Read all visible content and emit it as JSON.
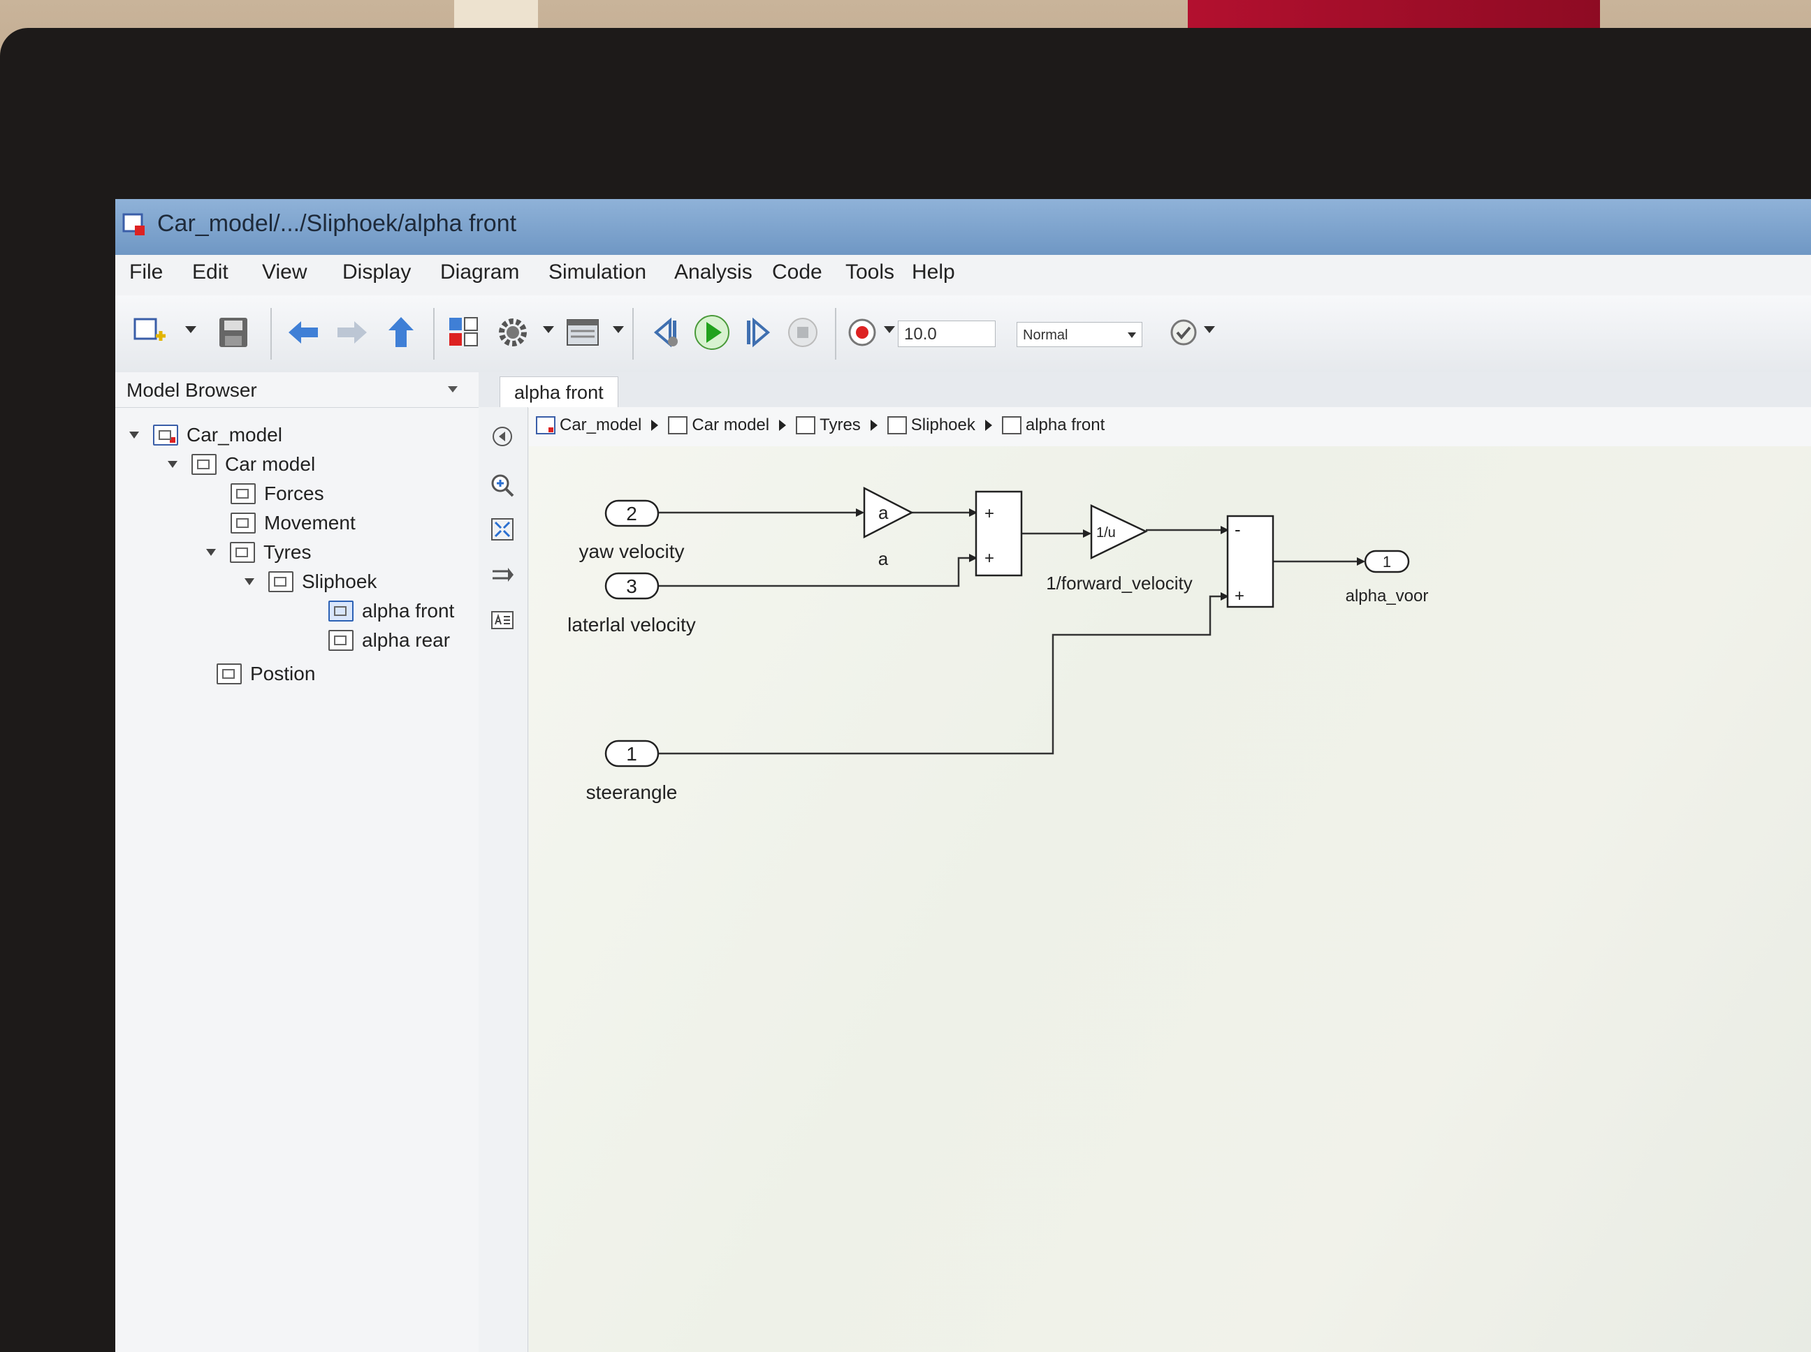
{
  "window": {
    "title": "Car_model/.../Sliphoek/alpha front"
  },
  "menu": [
    "File",
    "Edit",
    "View",
    "Display",
    "Diagram",
    "Simulation",
    "Analysis",
    "Code",
    "Tools",
    "Help"
  ],
  "toolbar": {
    "stop_time": "10.0",
    "sim_mode": "Normal",
    "icons": [
      "new-model-icon",
      "save-icon",
      "back-icon",
      "forward-icon",
      "up-icon",
      "library-browser-icon",
      "model-config-icon",
      "model-explorer-icon",
      "step-back-icon",
      "run-icon",
      "step-forward-icon",
      "stop-icon",
      "record-icon",
      "check-icon"
    ]
  },
  "model_browser": {
    "title": "Model Browser",
    "items": [
      {
        "label": "Car_model",
        "expanded": true
      },
      {
        "label": "Car model",
        "expanded": true
      },
      {
        "label": "Forces"
      },
      {
        "label": "Movement"
      },
      {
        "label": "Tyres",
        "expanded": true
      },
      {
        "label": "Sliphoek",
        "expanded": true
      },
      {
        "label": "alpha front",
        "selected": true
      },
      {
        "label": "alpha rear"
      },
      {
        "label": "Postion"
      }
    ]
  },
  "tab": {
    "label": "alpha front"
  },
  "breadcrumb": [
    "Car_model",
    "Car model",
    "Tyres",
    "Sliphoek",
    "alpha front"
  ],
  "diagram": {
    "inports": [
      {
        "number": "2",
        "label": "yaw velocity"
      },
      {
        "number": "3",
        "label": "laterlal velocity"
      },
      {
        "number": "1",
        "label": "steerangle"
      }
    ],
    "gain": {
      "symbol": "a",
      "label": "a"
    },
    "sum1": {
      "signs": [
        "+",
        "+"
      ]
    },
    "divide": {
      "symbol": "1/u",
      "label": "1/forward_velocity"
    },
    "sum2": {
      "signs": [
        "-",
        "+"
      ]
    },
    "outport": {
      "number": "1",
      "label": "alpha_voor"
    }
  }
}
